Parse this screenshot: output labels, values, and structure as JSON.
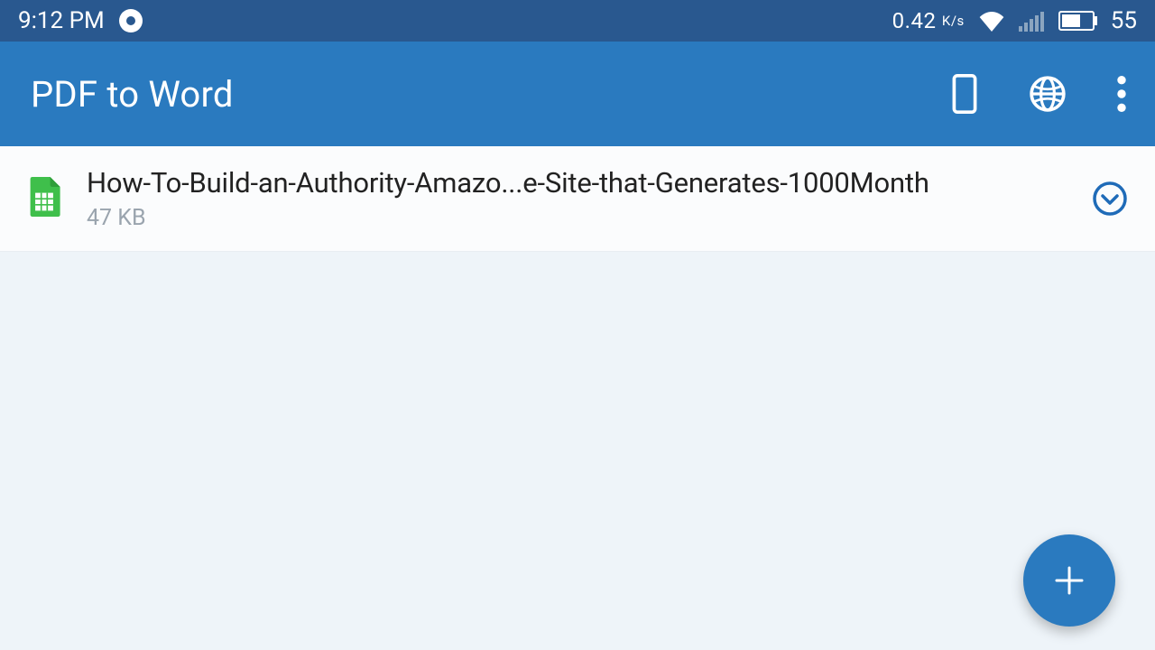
{
  "status": {
    "time": "9:12 PM",
    "speed": "0.42",
    "speed_unit": "K/s",
    "battery": "55"
  },
  "toolbar": {
    "title": "PDF to Word"
  },
  "files": [
    {
      "name": "How-To-Build-an-Authority-Amazo...e-Site-that-Generates-1000Month",
      "size": "47 KB"
    }
  ],
  "fab": {
    "label": "+"
  }
}
